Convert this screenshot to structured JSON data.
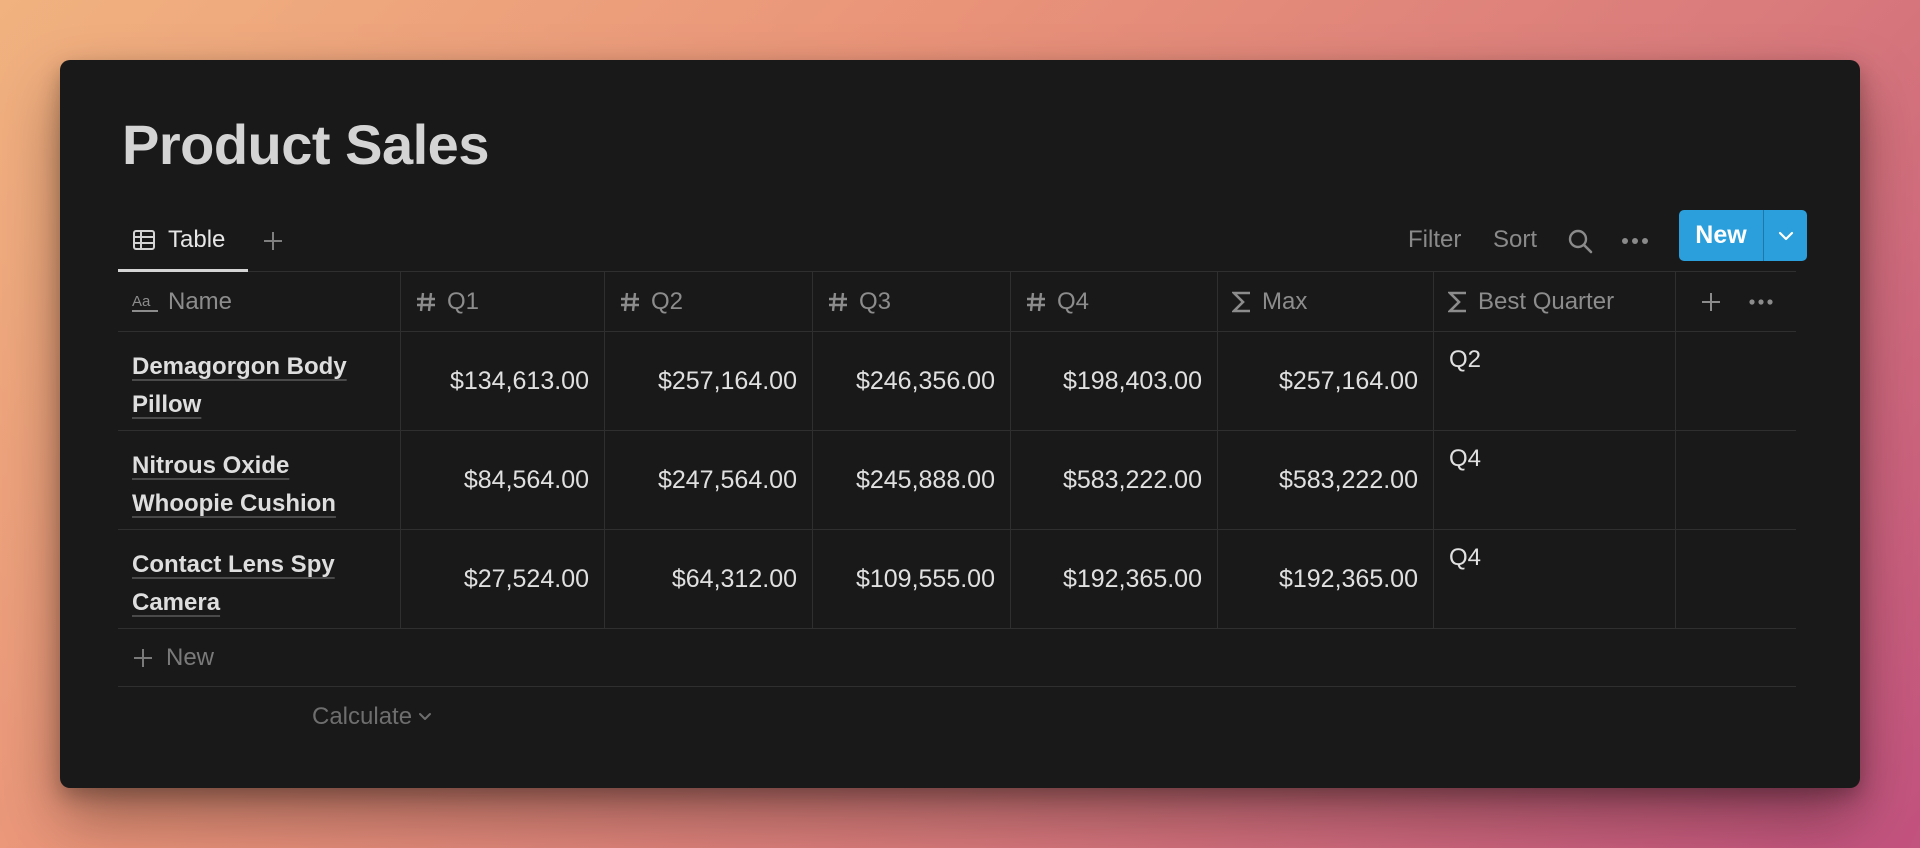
{
  "page": {
    "title": "Product Sales"
  },
  "views": {
    "active_tab": "Table",
    "add_view_icon": "plus-icon"
  },
  "toolbar": {
    "filter_label": "Filter",
    "sort_label": "Sort",
    "search_icon": "search-icon",
    "more_icon": "ellipsis-icon",
    "new_label": "New",
    "new_accent": "#2b9fdc"
  },
  "table": {
    "columns": [
      {
        "icon": "text-icon",
        "label": "Name"
      },
      {
        "icon": "hash-icon",
        "label": "Q1"
      },
      {
        "icon": "hash-icon",
        "label": "Q2"
      },
      {
        "icon": "hash-icon",
        "label": "Q3"
      },
      {
        "icon": "hash-icon",
        "label": "Q4"
      },
      {
        "icon": "sigma-icon",
        "label": "Max"
      },
      {
        "icon": "sigma-icon",
        "label": "Best Quarter"
      }
    ],
    "rows": [
      {
        "name": "Demagorgon Body Pillow",
        "q1": "$134,613.00",
        "q2": "$257,164.00",
        "q3": "$246,356.00",
        "q4": "$198,403.00",
        "max": "$257,164.00",
        "best": "Q2"
      },
      {
        "name": "Nitrous Oxide Whoopie Cushion",
        "q1": "$84,564.00",
        "q2": "$247,564.00",
        "q3": "$245,888.00",
        "q4": "$583,222.00",
        "max": "$583,222.00",
        "best": "Q4"
      },
      {
        "name": "Contact Lens Spy Camera",
        "q1": "$27,524.00",
        "q2": "$64,312.00",
        "q3": "$109,555.00",
        "q4": "$192,365.00",
        "max": "$192,365.00",
        "best": "Q4"
      }
    ],
    "new_row_label": "New",
    "calculate_label": "Calculate"
  },
  "colors": {
    "window_bg": "#191919",
    "border": "#2f2f2f",
    "muted_text": "#8c8c8c"
  }
}
